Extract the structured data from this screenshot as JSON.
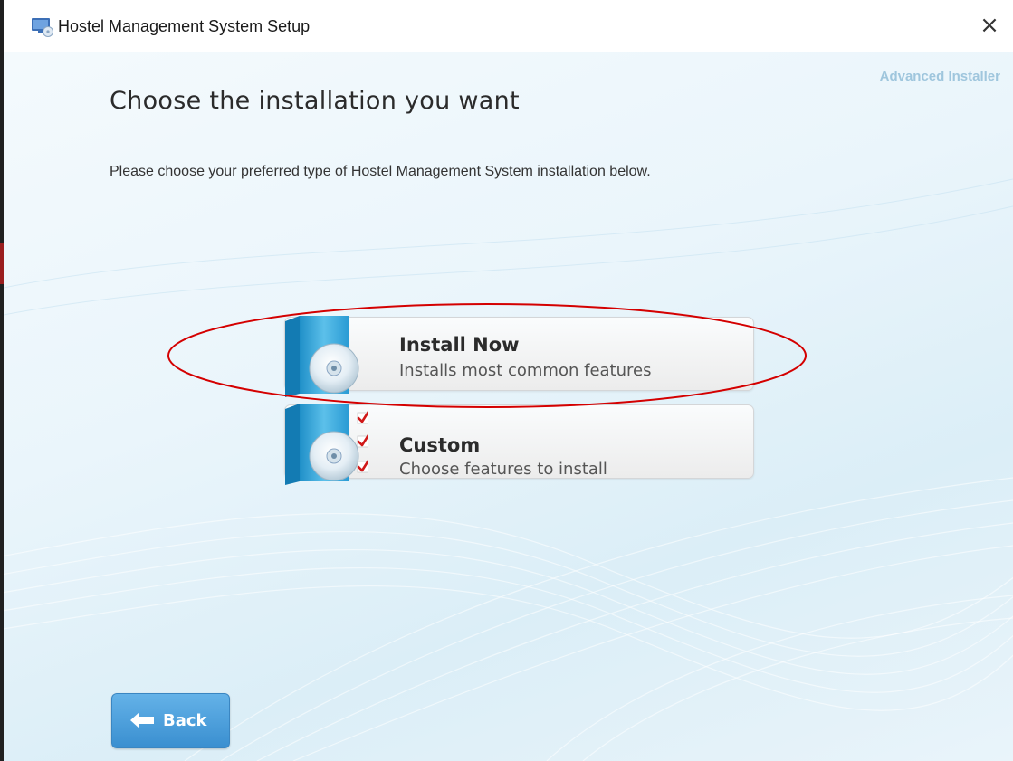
{
  "window": {
    "title": "Hostel Management System Setup",
    "close_glyph": "×",
    "app_icon": "installer-monitor-icon"
  },
  "brand": "Advanced Installer",
  "heading": "Choose the installation you want",
  "subtext": "Please choose your preferred type of Hostel Management System installation below.",
  "options": [
    {
      "title": "Install Now",
      "description": "Installs most common features",
      "icon": "cd-box-icon",
      "highlighted": true
    },
    {
      "title": "Custom",
      "description": "Choose features to install",
      "icon": "cd-box-checklist-icon",
      "highlighted": false
    }
  ],
  "back_button": {
    "label": "Back",
    "icon": "left-arrow-icon"
  },
  "colors": {
    "accent": "#3a8fd0",
    "highlight_ring": "#d40000",
    "checkmark": "#d01818",
    "brand_text": "#9fc6dd"
  }
}
